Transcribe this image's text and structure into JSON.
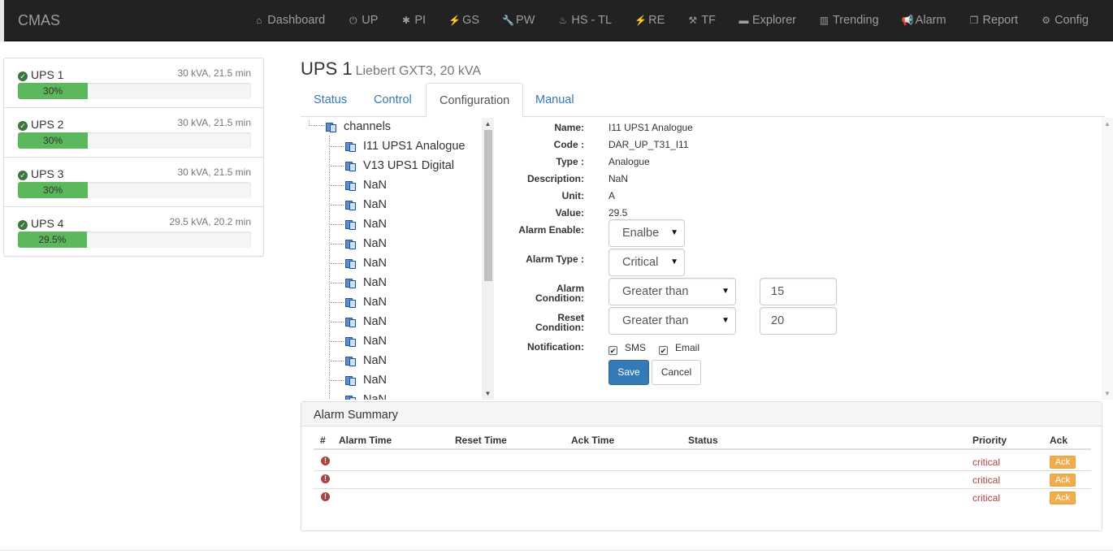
{
  "navbar": {
    "brand": "CMAS",
    "items": [
      {
        "label": "Dashboard",
        "icon": "home-icon",
        "glyph": "⌂"
      },
      {
        "label": "UP",
        "icon": "power-icon",
        "glyph": "⏻"
      },
      {
        "label": "PI",
        "icon": "asterisk-icon",
        "glyph": "✱"
      },
      {
        "label": "GS",
        "icon": "plug-icon",
        "glyph": "⚡"
      },
      {
        "label": "PW",
        "icon": "wrench-icon",
        "glyph": "🔧"
      },
      {
        "label": "HS - TL",
        "icon": "fire-icon",
        "glyph": "♨"
      },
      {
        "label": "RE",
        "icon": "plug-icon",
        "glyph": "⚡"
      },
      {
        "label": "TF",
        "icon": "wand-icon",
        "glyph": "⚒"
      },
      {
        "label": "Explorer",
        "icon": "folder-icon",
        "glyph": "▬"
      },
      {
        "label": "Trending",
        "icon": "bar-chart-icon",
        "glyph": "▥"
      },
      {
        "label": "Alarm",
        "icon": "bullhorn-icon",
        "glyph": "📢"
      },
      {
        "label": "Report",
        "icon": "copy-icon",
        "glyph": "❐"
      },
      {
        "label": "Config",
        "icon": "cog-icon",
        "glyph": "⚙"
      }
    ]
  },
  "ups_list": [
    {
      "name": "UPS 1",
      "meta": "30 kVA, 21.5 min",
      "progress_label": "30%",
      "progress": 30
    },
    {
      "name": "UPS 2",
      "meta": "30 kVA, 21.5 min",
      "progress_label": "30%",
      "progress": 30
    },
    {
      "name": "UPS 3",
      "meta": "30 kVA, 21.5 min",
      "progress_label": "30%",
      "progress": 30
    },
    {
      "name": "UPS 4",
      "meta": "29.5 kVA, 20.2 min",
      "progress_label": "29.5%",
      "progress": 29.5
    }
  ],
  "header": {
    "title": "UPS 1",
    "subtitle": "Liebert GXT3, 20 kVA"
  },
  "tabs": [
    {
      "label": "Status"
    },
    {
      "label": "Control"
    },
    {
      "label": "Configuration",
      "active": true
    },
    {
      "label": "Manual"
    }
  ],
  "tree": {
    "root": "channels",
    "items": [
      "I11 UPS1 Analogue",
      "V13 UPS1 Digital",
      "NaN",
      "NaN",
      "NaN",
      "NaN",
      "NaN",
      "NaN",
      "NaN",
      "NaN",
      "NaN",
      "NaN",
      "NaN",
      "NaN"
    ]
  },
  "form": {
    "name_label": "Name:",
    "name_value": "I11 UPS1 Analogue",
    "code_label": "Code :",
    "code_value": "DAR_UP_T31_I11",
    "type_label": "Type :",
    "type_value": "Analogue",
    "description_label": "Description:",
    "description_value": "NaN",
    "unit_label": "Unit:",
    "unit_value": "A",
    "value_label": "Value:",
    "value_value": "29.5",
    "alarm_enable_label": "Alarm Enable:",
    "alarm_enable_value": "Enalbe",
    "alarm_type_label": "Alarm Type :",
    "alarm_type_value": "Critical",
    "alarm_condition_label_1": "Alarm",
    "alarm_condition_label_2": "Condition:",
    "alarm_condition_value": "Greater than",
    "alarm_threshold": "15",
    "reset_condition_label_1": "Reset",
    "reset_condition_label_2": "Condition:",
    "reset_condition_value": "Greater than",
    "reset_threshold": "20",
    "notification_label": "Notification:",
    "sms_label": "SMS",
    "email_label": "Email",
    "save_label": "Save",
    "cancel_label": "Cancel"
  },
  "alarm_summary": {
    "title": "Alarm Summary",
    "columns": [
      "#",
      "Alarm Time",
      "Reset Time",
      "Ack Time",
      "Status",
      "Priority",
      "Ack"
    ],
    "rows": [
      {
        "priority": "critical",
        "ack": "Ack"
      },
      {
        "priority": "critical",
        "ack": "Ack"
      },
      {
        "priority": "critical",
        "ack": "Ack"
      }
    ]
  },
  "colors": {
    "navbar": "#222222",
    "primary": "#337ab7",
    "success": "#5cb85c",
    "warning": "#f0ad4e",
    "danger": "#a94442"
  }
}
